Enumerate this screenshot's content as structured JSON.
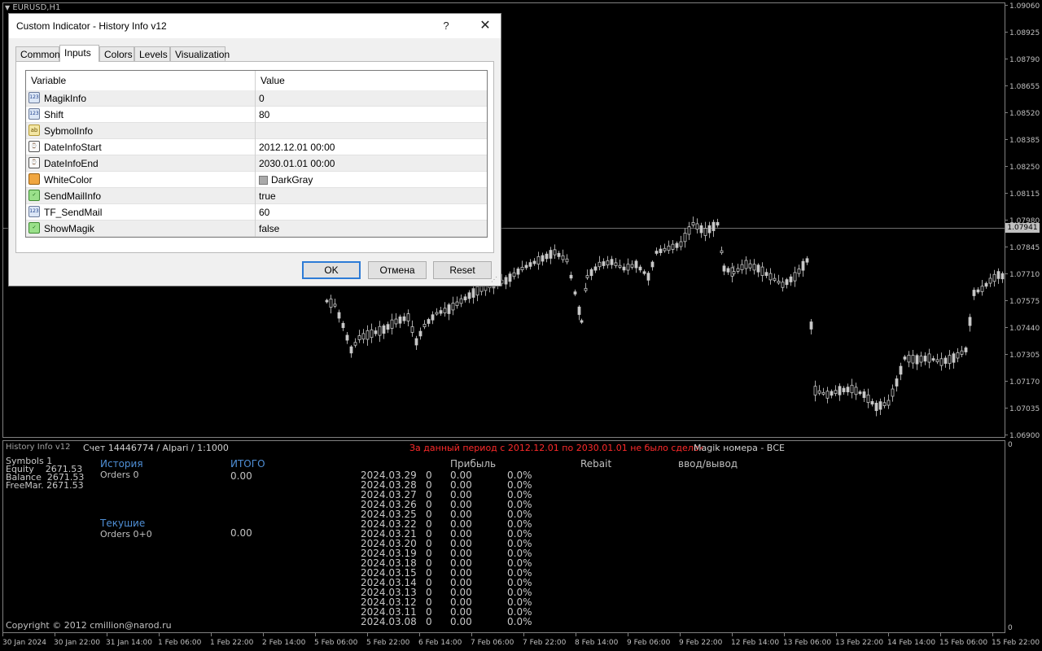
{
  "chart_header": {
    "symbol_label": "EURUSD,H1"
  },
  "price_scale": [
    "1.09060",
    "1.08925",
    "1.08790",
    "1.08655",
    "1.08520",
    "1.08385",
    "1.08250",
    "1.08115",
    "1.07980",
    "1.07845",
    "1.07710",
    "1.07575",
    "1.07440",
    "1.07305",
    "1.07170",
    "1.07035",
    "1.06900"
  ],
  "current_price": "1.07941",
  "time_axis": [
    "30 Jan 2024",
    "30 Jan 22:00",
    "31 Jan 14:00",
    "1 Feb 06:00",
    "1 Feb 22:00",
    "2 Feb 14:00",
    "5 Feb 06:00",
    "5 Feb 22:00",
    "6 Feb 14:00",
    "7 Feb 06:00",
    "7 Feb 22:00",
    "8 Feb 14:00",
    "9 Feb 06:00",
    "9 Feb 22:00",
    "12 Feb 14:00",
    "13 Feb 06:00",
    "13 Feb 22:00",
    "14 Feb 14:00",
    "15 Feb 06:00",
    "15 Feb 22:00"
  ],
  "sub_scale": {
    "top": "0",
    "bottom": "0"
  },
  "indicator": {
    "name": "History Info v12",
    "account": "Счет 14446774 / Alpari / 1:1000",
    "warning": "За данный период с 2012.12.01 по 2030.01.01 не было сделок",
    "magik_label": "Magik номера - ВСЕ",
    "symbols_label": "Symbols",
    "symbols_value": "1",
    "equity_label": "Equity",
    "equity_value": "2671.53",
    "balance_label": "Balance",
    "balance_value": "2671.53",
    "freemar_label": "FreeMar.",
    "freemar_value": "2671.53",
    "history_header": "История",
    "history_orders": "Orders 0",
    "total_header": "ИТОГО",
    "total_value": "0.00",
    "current_header": "Текушие",
    "current_orders": "Orders 0+0",
    "current_value": "0.00",
    "profit_header": "Прибыль",
    "rebait_header": "Rebait",
    "inout_header": "ввод/вывод",
    "copyright": "Copyright © 2012 cmillion@narod.ru",
    "rows": [
      {
        "date": "2024.03.29",
        "count": "0",
        "profit": "0.00",
        "pct": "0.0%"
      },
      {
        "date": "2024.03.28",
        "count": "0",
        "profit": "0.00",
        "pct": "0.0%"
      },
      {
        "date": "2024.03.27",
        "count": "0",
        "profit": "0.00",
        "pct": "0.0%"
      },
      {
        "date": "2024.03.26",
        "count": "0",
        "profit": "0.00",
        "pct": "0.0%"
      },
      {
        "date": "2024.03.25",
        "count": "0",
        "profit": "0.00",
        "pct": "0.0%"
      },
      {
        "date": "2024.03.22",
        "count": "0",
        "profit": "0.00",
        "pct": "0.0%"
      },
      {
        "date": "2024.03.21",
        "count": "0",
        "profit": "0.00",
        "pct": "0.0%"
      },
      {
        "date": "2024.03.20",
        "count": "0",
        "profit": "0.00",
        "pct": "0.0%"
      },
      {
        "date": "2024.03.19",
        "count": "0",
        "profit": "0.00",
        "pct": "0.0%"
      },
      {
        "date": "2024.03.18",
        "count": "0",
        "profit": "0.00",
        "pct": "0.0%"
      },
      {
        "date": "2024.03.15",
        "count": "0",
        "profit": "0.00",
        "pct": "0.0%"
      },
      {
        "date": "2024.03.14",
        "count": "0",
        "profit": "0.00",
        "pct": "0.0%"
      },
      {
        "date": "2024.03.13",
        "count": "0",
        "profit": "0.00",
        "pct": "0.0%"
      },
      {
        "date": "2024.03.12",
        "count": "0",
        "profit": "0.00",
        "pct": "0.0%"
      },
      {
        "date": "2024.03.11",
        "count": "0",
        "profit": "0.00",
        "pct": "0.0%"
      },
      {
        "date": "2024.03.08",
        "count": "0",
        "profit": "0.00",
        "pct": "0.0%"
      }
    ]
  },
  "dialog": {
    "title": "Custom Indicator - History Info v12",
    "help_glyph": "?",
    "close_glyph": "✕",
    "tabs": [
      "Common",
      "Inputs",
      "Colors",
      "Levels",
      "Visualization"
    ],
    "active_tab": "Inputs",
    "col_variable": "Variable",
    "col_value": "Value",
    "params": [
      {
        "name": "MagikInfo",
        "value": "0",
        "icon": "number-icon",
        "glyph": "123"
      },
      {
        "name": "Shift",
        "value": "80",
        "icon": "number-icon",
        "glyph": "123"
      },
      {
        "name": "SybmolInfo",
        "value": "",
        "icon": "string-icon",
        "glyph": "ab"
      },
      {
        "name": "DateInfoStart",
        "value": "2012.12.01 00:00",
        "icon": "datetime-icon",
        "glyph": "⌚"
      },
      {
        "name": "DateInfoEnd",
        "value": "2030.01.01 00:00",
        "icon": "datetime-icon",
        "glyph": "⌚"
      },
      {
        "name": "WhiteColor",
        "value": "DarkGray",
        "icon": "color-icon",
        "glyph": ""
      },
      {
        "name": "SendMailInfo",
        "value": "true",
        "icon": "bool-icon",
        "glyph": "✓"
      },
      {
        "name": "TF_SendMail",
        "value": "60",
        "icon": "number-icon",
        "glyph": "123"
      },
      {
        "name": "ShowMagik",
        "value": "false",
        "icon": "bool-icon",
        "glyph": "✓"
      }
    ],
    "ok_label": "OK",
    "cancel_label": "Отмена",
    "reset_label": "Reset"
  },
  "colors": {
    "background": "#000000",
    "grid": "#2a2a2a",
    "candle": "#c8c8c8",
    "warning": "#ff2a2a",
    "header_blue": "#4f8fd6",
    "dialog_bg": "#f0f0f0"
  }
}
